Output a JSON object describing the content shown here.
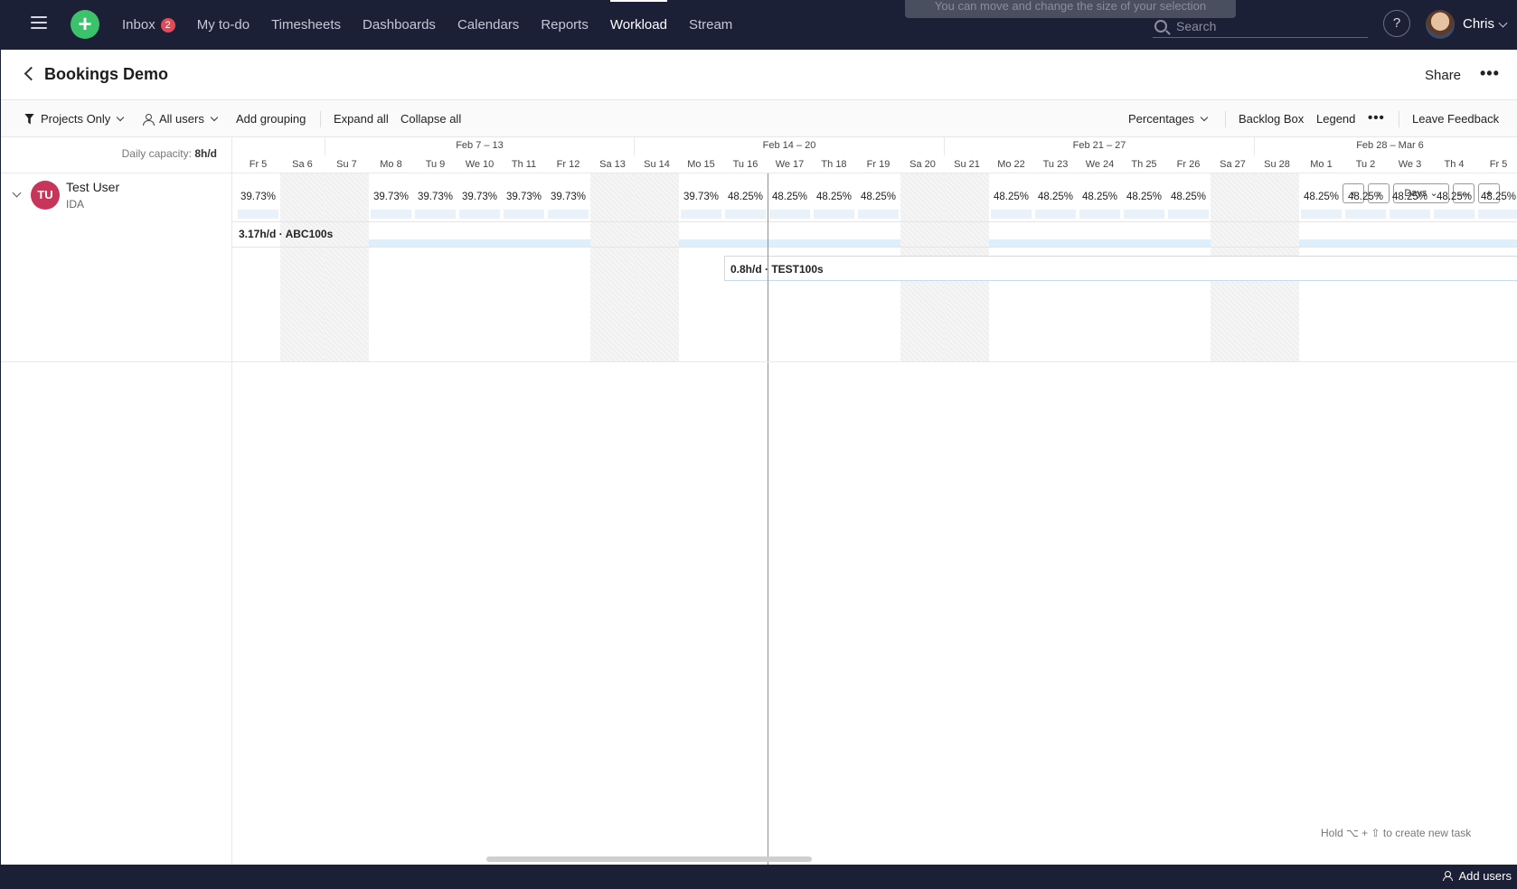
{
  "nav": {
    "items": [
      {
        "label": "Inbox",
        "badge": "2"
      },
      {
        "label": "My to-do"
      },
      {
        "label": "Timesheets"
      },
      {
        "label": "Dashboards"
      },
      {
        "label": "Calendars"
      },
      {
        "label": "Reports"
      },
      {
        "label": "Workload",
        "active": true
      },
      {
        "label": "Stream"
      }
    ],
    "toast": "You can move and change the size of your selection",
    "search_placeholder": "Search",
    "help": "?",
    "user": "Chris"
  },
  "header": {
    "title": "Bookings Demo",
    "share": "Share",
    "more": "•••"
  },
  "toolbar": {
    "filter": "Projects Only",
    "users": "All users",
    "add_grouping": "Add grouping",
    "expand_all": "Expand all",
    "collapse_all": "Collapse all",
    "percentages": "Percentages",
    "backlog": "Backlog Box",
    "legend": "Legend",
    "more": "•••",
    "feedback": "Leave Feedback"
  },
  "timeline": {
    "capacity_label": "Daily capacity:",
    "capacity_value": "8h/d",
    "weeks": [
      "Feb 7 – 13",
      "Feb 14 – 20",
      "Feb 21 – 27",
      "Feb 28 – Mar 6"
    ],
    "days": [
      "Fr 5",
      "Sa 6",
      "Su 7",
      "Mo 8",
      "Tu 9",
      "We 10",
      "Th 11",
      "Fr 12",
      "Sa 13",
      "Su 14",
      "Mo 15",
      "Tu 16",
      "We 17",
      "Th 18",
      "Fr 19",
      "Sa 20",
      "Su 21",
      "Mo 22",
      "Tu 23",
      "We 24",
      "Th 25",
      "Fr 26",
      "Sa 27",
      "Su 28",
      "Mo 1",
      "Tu 2",
      "We 3",
      "Th 4",
      "Fr 5"
    ],
    "weekend_days": [
      1,
      2,
      8,
      9,
      15,
      16,
      22,
      23
    ],
    "user": {
      "initials": "TU",
      "name": "Test User",
      "subtitle": "IDA",
      "avatar_color": "#c7355a"
    },
    "utilization": [
      "39.73%",
      "",
      "",
      "39.73%",
      "39.73%",
      "39.73%",
      "39.73%",
      "39.73%",
      "",
      "",
      "39.73%",
      "48.25%",
      "48.25%",
      "48.25%",
      "48.25%",
      "",
      "",
      "48.25%",
      "48.25%",
      "48.25%",
      "48.25%",
      "48.25%",
      "",
      "",
      "48.25%",
      "48.25%",
      "48.25%",
      "48.25%",
      "48.25%"
    ],
    "task1": "3.17h/d · ABC100s",
    "task2": "0.8h/d · TEST100s",
    "zoom": {
      "prev": "‹",
      "next": "›",
      "scale": "Days ⌄",
      "minus": "—",
      "plus": "+"
    },
    "hint": "Hold ⌥ + ⇧ to create new task",
    "today_color": "#e46a72"
  },
  "footer": {
    "add_users": "Add users"
  }
}
